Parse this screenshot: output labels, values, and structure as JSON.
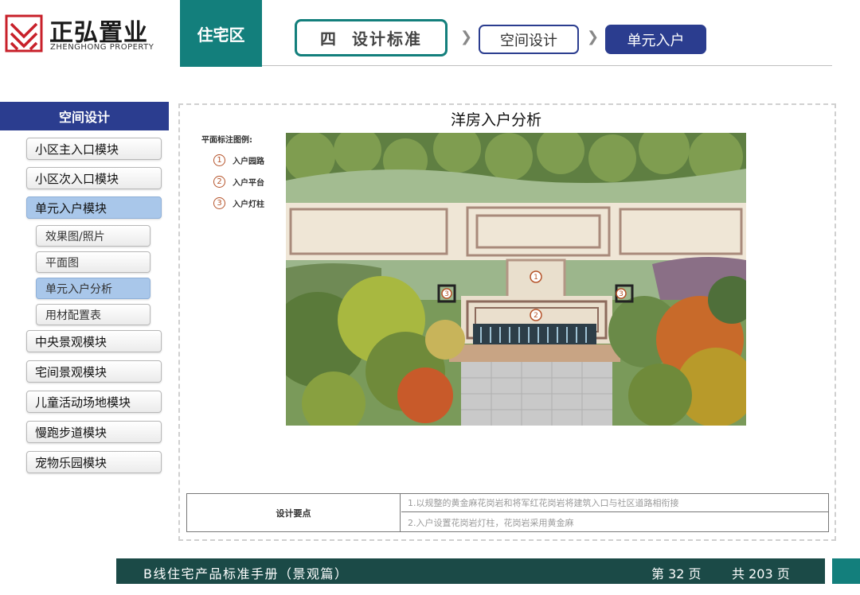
{
  "brand": {
    "name_cn": "正弘置业",
    "name_en": "ZHENGHONG PROPERTY"
  },
  "header": {
    "zone": "住宅区",
    "section_num": "四",
    "section_title": "设计标准",
    "crumb_1": "空间设计",
    "crumb_2": "单元入户"
  },
  "sidebar": {
    "title": "空间设计",
    "items": [
      {
        "label": "小区主入口模块"
      },
      {
        "label": "小区次入口模块"
      },
      {
        "label": "单元入户模块"
      },
      {
        "label": "中央景观模块"
      },
      {
        "label": "宅间景观模块"
      },
      {
        "label": "儿童活动场地模块"
      },
      {
        "label": "慢跑步道模块"
      },
      {
        "label": "宠物乐园模块"
      }
    ],
    "subitems": [
      {
        "label": "效果图/照片"
      },
      {
        "label": "平面图"
      },
      {
        "label": "单元入户分析"
      },
      {
        "label": "用材配置表"
      }
    ],
    "active_item": "单元入户模块",
    "active_subitem": "单元入户分析"
  },
  "main": {
    "title": "洋房入户分析",
    "legend": {
      "title": "平面标注图例:",
      "items": [
        {
          "num": "1",
          "label": "入户园路"
        },
        {
          "num": "2",
          "label": "入户平台"
        },
        {
          "num": "3",
          "label": "入户灯柱"
        }
      ]
    },
    "plan_markers": [
      "1",
      "2",
      "3",
      "3"
    ],
    "notes": {
      "label": "设计要点",
      "lines": [
        "1.以规整的黄金麻花岗岩和将军红花岗岩将建筑入口与社区道路相衔接",
        "2.入户设置花岗岩灯柱，花岗岩采用黄金麻"
      ]
    }
  },
  "footer": {
    "title": "B线住宅产品标准手册（景观篇）",
    "page": "第 32 页",
    "total": "共 203 页"
  },
  "colors": {
    "teal": "#137f7c",
    "navy": "#2b3d8f",
    "footer_bg": "#1b4a47",
    "active_item": "#a9c7ea",
    "marker": "#b5532a"
  }
}
